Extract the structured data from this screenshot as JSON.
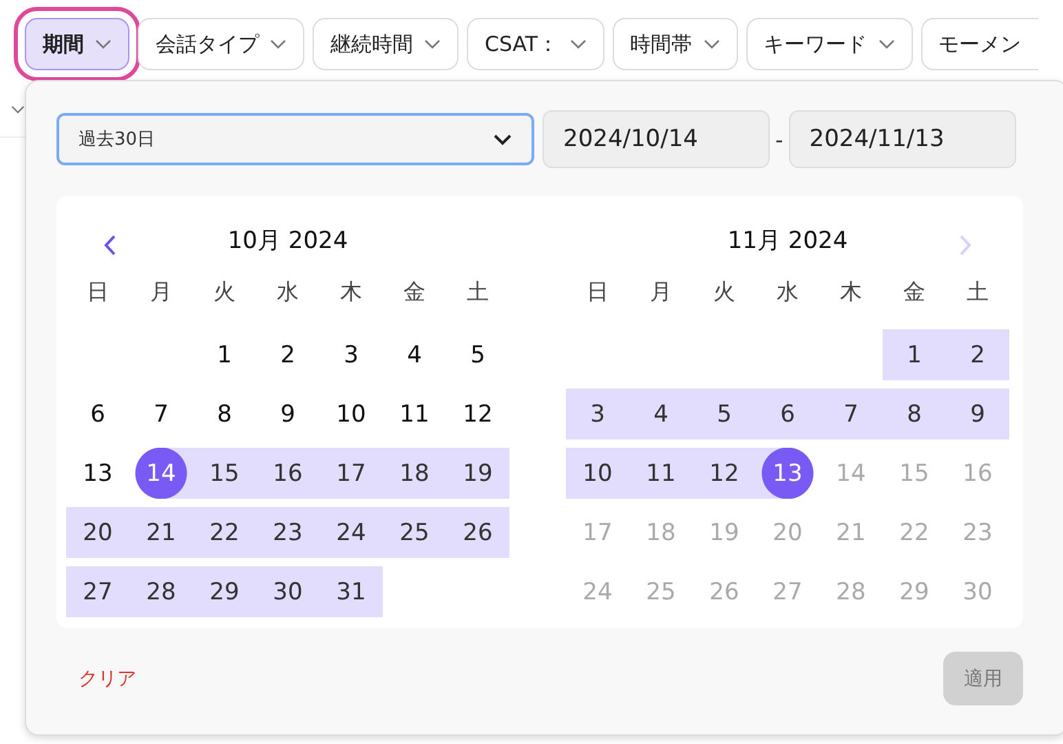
{
  "filters": [
    {
      "label": "期間",
      "selected": true
    },
    {
      "label": "会話タイプ",
      "selected": false
    },
    {
      "label": "継続時間",
      "selected": false
    },
    {
      "label": "CSAT：",
      "selected": false
    },
    {
      "label": "時間帯",
      "selected": false
    },
    {
      "label": "キーワード",
      "selected": false
    },
    {
      "label": "モーメン",
      "selected": false
    }
  ],
  "popup": {
    "preset": {
      "value": "過去30日"
    },
    "start_date": "2024/10/14",
    "separator": "-",
    "end_date": "2024/11/13",
    "months": [
      {
        "title": "10月 2024",
        "nav": {
          "kind": "prev",
          "disabled": false
        },
        "weekdays": [
          "日",
          "月",
          "火",
          "水",
          "木",
          "金",
          "土"
        ],
        "weeks": [
          [
            {
              "kind": "blank"
            },
            {
              "kind": "blank"
            },
            {
              "day": "1",
              "kind": "plain"
            },
            {
              "day": "2",
              "kind": "plain"
            },
            {
              "day": "3",
              "kind": "plain"
            },
            {
              "day": "4",
              "kind": "plain"
            },
            {
              "day": "5",
              "kind": "plain"
            }
          ],
          [
            {
              "day": "6",
              "kind": "plain"
            },
            {
              "day": "7",
              "kind": "plain"
            },
            {
              "day": "8",
              "kind": "plain"
            },
            {
              "day": "9",
              "kind": "plain"
            },
            {
              "day": "10",
              "kind": "plain"
            },
            {
              "day": "11",
              "kind": "plain"
            },
            {
              "day": "12",
              "kind": "plain"
            }
          ],
          [
            {
              "day": "13",
              "kind": "plain"
            },
            {
              "day": "14",
              "kind": "start"
            },
            {
              "day": "15",
              "kind": "range"
            },
            {
              "day": "16",
              "kind": "range"
            },
            {
              "day": "17",
              "kind": "range"
            },
            {
              "day": "18",
              "kind": "range"
            },
            {
              "day": "19",
              "kind": "range"
            }
          ],
          [
            {
              "day": "20",
              "kind": "range"
            },
            {
              "day": "21",
              "kind": "range"
            },
            {
              "day": "22",
              "kind": "range"
            },
            {
              "day": "23",
              "kind": "range"
            },
            {
              "day": "24",
              "kind": "range"
            },
            {
              "day": "25",
              "kind": "range"
            },
            {
              "day": "26",
              "kind": "range"
            }
          ],
          [
            {
              "day": "27",
              "kind": "range"
            },
            {
              "day": "28",
              "kind": "range"
            },
            {
              "day": "29",
              "kind": "range"
            },
            {
              "day": "30",
              "kind": "range"
            },
            {
              "day": "31",
              "kind": "range"
            }
          ]
        ]
      },
      {
        "title": "11月 2024",
        "nav": {
          "kind": "next",
          "disabled": true
        },
        "weekdays": [
          "日",
          "月",
          "火",
          "水",
          "木",
          "金",
          "土"
        ],
        "weeks": [
          [
            {
              "kind": "blank"
            },
            {
              "kind": "blank"
            },
            {
              "kind": "blank"
            },
            {
              "kind": "blank"
            },
            {
              "kind": "blank"
            },
            {
              "day": "1",
              "kind": "range"
            },
            {
              "day": "2",
              "kind": "range"
            }
          ],
          [
            {
              "day": "3",
              "kind": "range"
            },
            {
              "day": "4",
              "kind": "range"
            },
            {
              "day": "5",
              "kind": "range"
            },
            {
              "day": "6",
              "kind": "range"
            },
            {
              "day": "7",
              "kind": "range"
            },
            {
              "day": "8",
              "kind": "range"
            },
            {
              "day": "9",
              "kind": "range"
            }
          ],
          [
            {
              "day": "10",
              "kind": "range"
            },
            {
              "day": "11",
              "kind": "range"
            },
            {
              "day": "12",
              "kind": "range"
            },
            {
              "day": "13",
              "kind": "end"
            },
            {
              "day": "14",
              "kind": "disabled"
            },
            {
              "day": "15",
              "kind": "disabled"
            },
            {
              "day": "16",
              "kind": "disabled"
            }
          ],
          [
            {
              "day": "17",
              "kind": "disabled"
            },
            {
              "day": "18",
              "kind": "disabled"
            },
            {
              "day": "19",
              "kind": "disabled"
            },
            {
              "day": "20",
              "kind": "disabled"
            },
            {
              "day": "21",
              "kind": "disabled"
            },
            {
              "day": "22",
              "kind": "disabled"
            },
            {
              "day": "23",
              "kind": "disabled"
            }
          ],
          [
            {
              "day": "24",
              "kind": "disabled"
            },
            {
              "day": "25",
              "kind": "disabled"
            },
            {
              "day": "26",
              "kind": "disabled"
            },
            {
              "day": "27",
              "kind": "disabled"
            },
            {
              "day": "28",
              "kind": "disabled"
            },
            {
              "day": "29",
              "kind": "disabled"
            },
            {
              "day": "30",
              "kind": "disabled"
            }
          ]
        ]
      }
    ],
    "clear_button": "クリア",
    "apply_button": {
      "label": "適用",
      "disabled": true
    }
  }
}
